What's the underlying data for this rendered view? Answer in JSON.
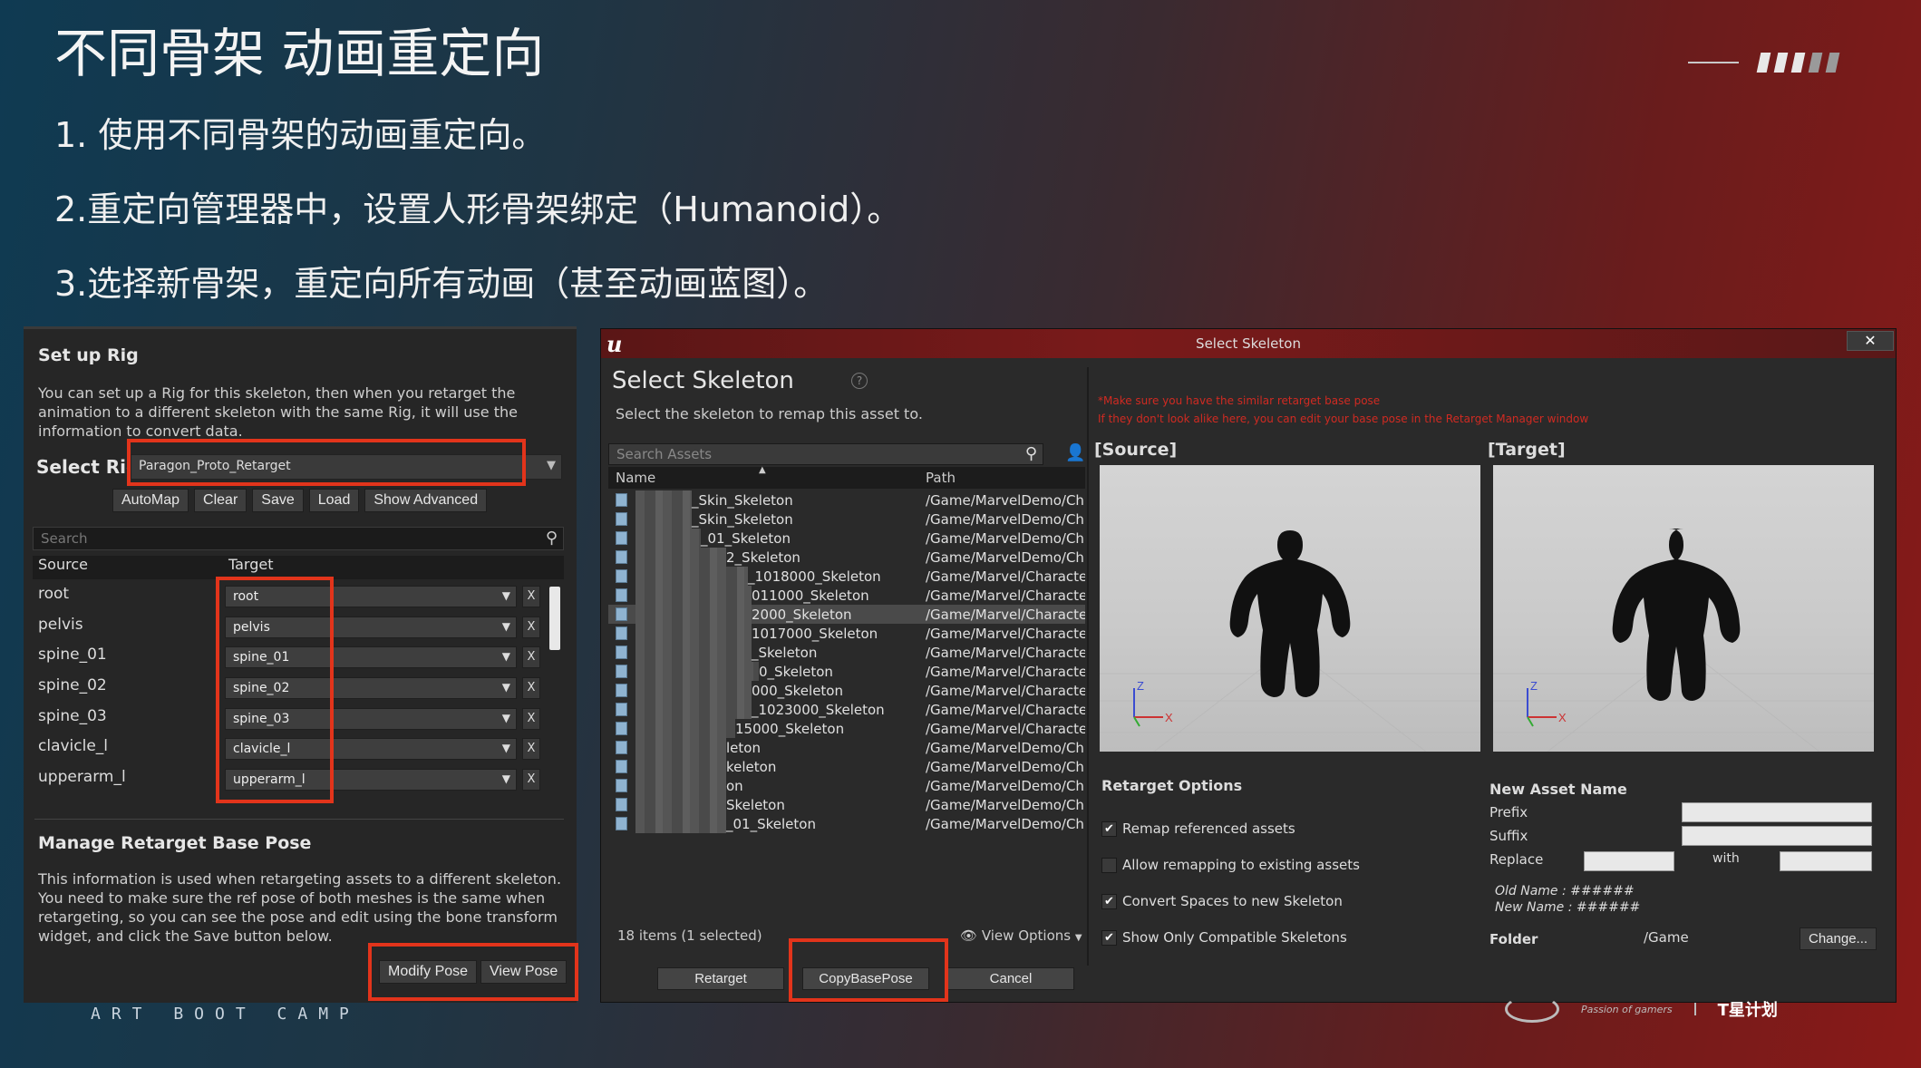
{
  "slide": {
    "title": "不同骨架 动画重定向",
    "bullets": [
      "1. 使用不同骨架的动画重定向。",
      "2.重定向管理器中，设置人形骨架绑定（Humanoid）。",
      "3.选择新骨架，重定向所有动画（甚至动画蓝图）。"
    ],
    "footer_left": "ART BOOT CAMP",
    "footer_tagline": "Passion of gamers",
    "footer_brand": "T星计划"
  },
  "rig_panel": {
    "setup_title": "Set up Rig",
    "setup_desc": "You can set up a Rig for this skeleton, then when you retarget the animation to a different skeleton with the same Rig, it will use the information to convert data.",
    "select_rig_label": "Select Rig",
    "select_rig_value": "Paragon_Proto_Retarget",
    "buttons": [
      "AutoMap",
      "Clear",
      "Save",
      "Load",
      "Show Advanced"
    ],
    "search_placeholder": "Search",
    "col_source": "Source",
    "col_target": "Target",
    "rows": [
      {
        "source": "root",
        "target": "root"
      },
      {
        "source": "pelvis",
        "target": "pelvis"
      },
      {
        "source": "spine_01",
        "target": "spine_01"
      },
      {
        "source": "spine_02",
        "target": "spine_02"
      },
      {
        "source": "spine_03",
        "target": "spine_03"
      },
      {
        "source": "clavicle_l",
        "target": "clavicle_l"
      },
      {
        "source": "upperarm_l",
        "target": "upperarm_l"
      }
    ],
    "remove_label": "X",
    "manage_title": "Manage Retarget Base Pose",
    "manage_desc": "This information is used when retargeting assets to a different skeleton. You need to make sure the ref pose of both meshes is the same when retargeting, so you can see the pose and edit using the bone transform widget, and click the Save button below.",
    "modify_pose": "Modify Pose",
    "view_pose": "View Pose"
  },
  "dialog": {
    "window_title": "Select Skeleton",
    "close_label": "✕",
    "heading": "Select Skeleton",
    "subheading": "Select the skeleton to remap this asset to.",
    "search_placeholder": "Search Assets",
    "col_name": "Name",
    "col_path": "Path",
    "assets": [
      {
        "name": "_Skin_Skeleton",
        "path": "/Game/MarvelDemo/Ch"
      },
      {
        "name": "_Skin_Skeleton",
        "path": "/Game/MarvelDemo/Ch"
      },
      {
        "name": "_01_Skeleton",
        "path": "/Game/MarvelDemo/Ch"
      },
      {
        "name": "2_Skeleton",
        "path": "/Game/MarvelDemo/Ch"
      },
      {
        "name": "_1018000_Skeleton",
        "path": "/Game/Marvel/Characte"
      },
      {
        "name": "011000_Skeleton",
        "path": "/Game/Marvel/Characte"
      },
      {
        "name": "2000_Skeleton",
        "path": "/Game/Marvel/Characte"
      },
      {
        "name": "1017000_Skeleton",
        "path": "/Game/Marvel/Characte"
      },
      {
        "name": "_Skeleton",
        "path": "/Game/Marvel/Characte"
      },
      {
        "name": "0_Skeleton",
        "path": "/Game/Marvel/Characte"
      },
      {
        "name": "000_Skeleton",
        "path": "/Game/Marvel/Characte"
      },
      {
        "name": "_1023000_Skeleton",
        "path": "/Game/Marvel/Characte"
      },
      {
        "name": "15000_Skeleton",
        "path": "/Game/Marvel/Characte"
      },
      {
        "name": "leton",
        "path": "/Game/MarvelDemo/Ch"
      },
      {
        "name": "keleton",
        "path": "/Game/MarvelDemo/Ch"
      },
      {
        "name": "on",
        "path": "/Game/MarvelDemo/Ch"
      },
      {
        "name": "Skeleton",
        "path": "/Game/MarvelDemo/Ch"
      },
      {
        "name": "_01_Skeleton",
        "path": "/Game/MarvelDemo/Ch"
      }
    ],
    "items_count": "18 items (1 selected)",
    "view_options": "View Options",
    "retarget": "Retarget",
    "copy_base_pose": "CopyBasePose",
    "cancel": "Cancel",
    "warning_1": "*Make sure you have the similar retarget base pose",
    "warning_2": "If they don't look alike here, you can edit your base pose in the Retarget Manager window",
    "source_label": "[Source]",
    "target_label": "[Target]",
    "axis_z": "Z",
    "axis_x": "X",
    "retarget_options": "Retarget Options",
    "options": [
      {
        "label": "Remap referenced assets",
        "checked": true
      },
      {
        "label": "Allow remapping to existing assets",
        "checked": false
      },
      {
        "label": "Convert Spaces to new Skeleton",
        "checked": true
      },
      {
        "label": "Show Only Compatible Skeletons",
        "checked": true
      }
    ],
    "new_asset_name": "New Asset Name",
    "prefix": "Prefix",
    "suffix": "Suffix",
    "replace": "Replace",
    "with": "with",
    "old_name": "Old Name : ######",
    "new_name": "New Name : ######",
    "folder": "Folder",
    "folder_value": "/Game",
    "change": "Change..."
  },
  "colors": {
    "highlight": "#e2341b",
    "warning": "#d02a22",
    "checkbox": "#ffffff"
  }
}
